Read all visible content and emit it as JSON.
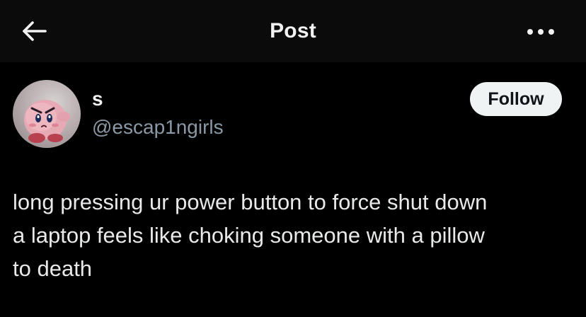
{
  "header": {
    "title": "Post",
    "back_icon": "arrow-left-icon",
    "more_icon": "more-horizontal-icon"
  },
  "author": {
    "display_name": "s",
    "handle": "@escap1ngirls",
    "avatar": "profile-avatar-image",
    "follow_label": "Follow"
  },
  "post": {
    "lines": [
      "long pressing ur power button to force shut down",
      "a laptop feels like choking someone with a pillow",
      "to death"
    ]
  },
  "colors": {
    "background": "#000000",
    "header_background": "#0b0b0b",
    "primary_text": "#e7e9ea",
    "secondary_text": "#8b98a5",
    "follow_button_bg": "#eff3f4",
    "follow_button_text": "#0f1419"
  }
}
